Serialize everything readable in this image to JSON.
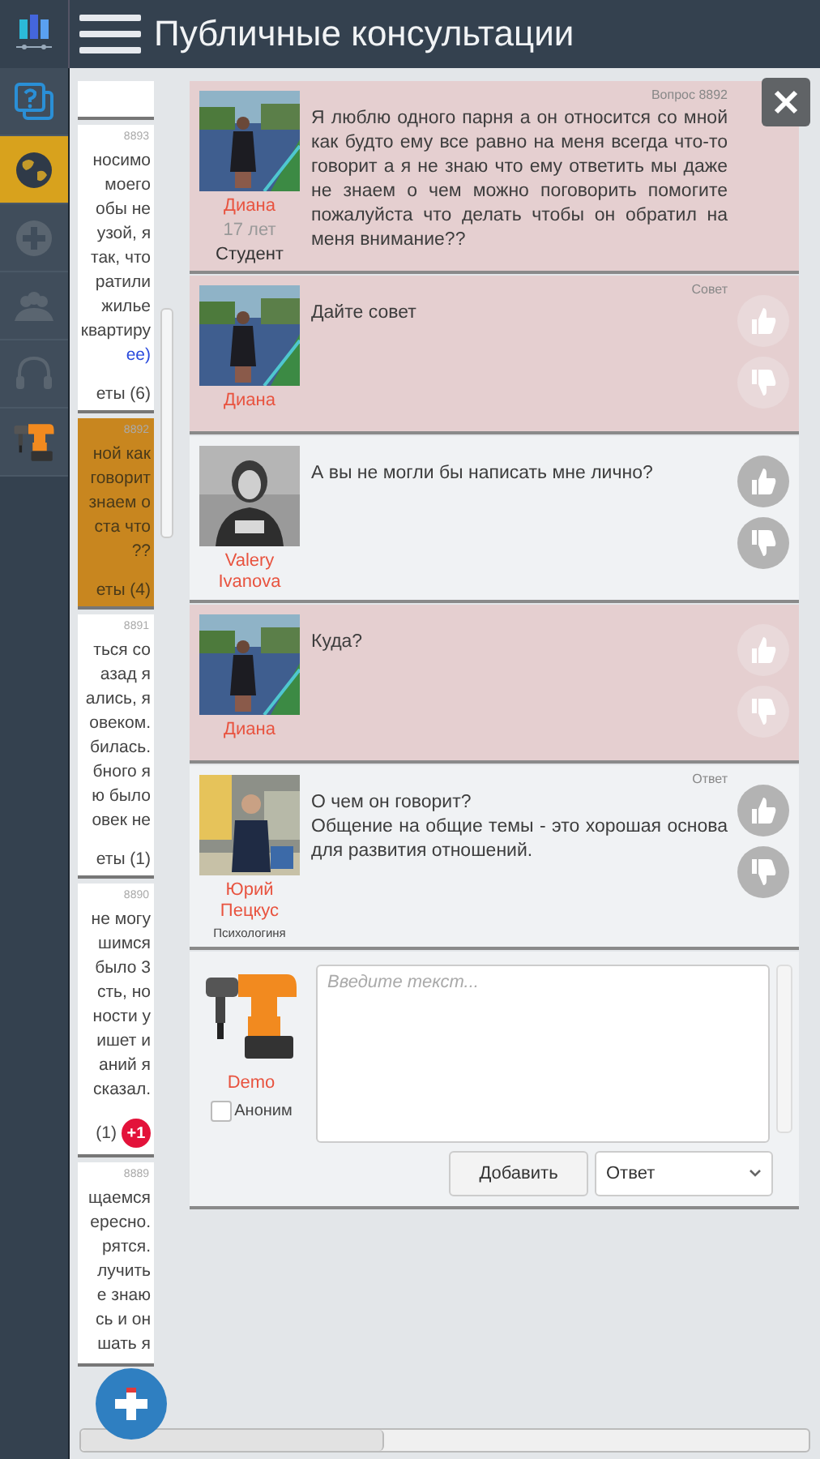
{
  "header": {
    "title": "Публичные консультации"
  },
  "rail": [
    {
      "kind": "question",
      "selected": false
    },
    {
      "kind": "globe",
      "selected": true
    },
    {
      "kind": "plus",
      "selected": false
    },
    {
      "kind": "people",
      "selected": false
    },
    {
      "kind": "headset",
      "selected": false
    },
    {
      "kind": "drill",
      "selected": false
    }
  ],
  "question_list": [
    {
      "selected": false
    },
    {
      "number": "8893",
      "lines": [
        "носимо",
        "моего",
        "обы не",
        "узой, я",
        "так, что",
        "ратили",
        "жилье",
        "квартиру"
      ],
      "link": "ее)",
      "replies": "еты (6)",
      "selected": false
    },
    {
      "number": "8892",
      "lines": [
        "ной как",
        "говорит",
        "знаем о",
        "ста что",
        "??"
      ],
      "replies": "еты (4)",
      "selected": true
    },
    {
      "number": "8891",
      "lines": [
        "ться со",
        "азад я",
        "ались, я",
        "овеком.",
        "билась.",
        "бного я",
        "ю было",
        "овек не"
      ],
      "replies": "еты (1)",
      "selected": false
    },
    {
      "number": "8890",
      "lines": [
        "не могу",
        "шимся",
        "было 3",
        "сть, но",
        "ности у",
        "ишет и",
        "аний я",
        "сказал."
      ],
      "replies": "(1)",
      "badge": "+1",
      "selected": false
    },
    {
      "number": "8889",
      "lines": [
        "щаемся",
        "ересно.",
        "рятся.",
        "лучить",
        "е знаю",
        "сь и он",
        "шать я"
      ],
      "selected": false
    }
  ],
  "messages": [
    {
      "highlighted": true,
      "label": "Вопрос 8892",
      "name": "Диана",
      "age": "17 лет",
      "role": "Студент",
      "text": "Я люблю одного парня а он относится со мной как будто ему все равно на меня всегда что-то говорит а я не знаю что ему ответить мы даже не знаем о чем можно поговорить помогите пожалуйста что делать чтобы он обратил на меня внимание??"
    },
    {
      "highlighted": true,
      "label": "Совет",
      "name": "Диана",
      "text": "Дайте совет",
      "votes_active": false
    },
    {
      "highlighted": false,
      "name": "Valery Ivanova",
      "text": "А вы не могли бы написать мне лично?",
      "votes_active": true
    },
    {
      "highlighted": true,
      "name": "Диана",
      "text": "Куда?",
      "votes_active": false
    },
    {
      "highlighted": false,
      "label": "Ответ",
      "name": "Юрий Пецкус",
      "role_small": "Психологиня",
      "text": "О чем он говорит?\nОбщение на общие темы - это хорошая основа для развития отношений.",
      "votes_active": true
    }
  ],
  "composer": {
    "name": "Demo",
    "anonymous": {
      "label": "Аноним",
      "checked": false
    },
    "placeholder": "Введите текст...",
    "button": "Добавить",
    "type_select": "Ответ"
  }
}
